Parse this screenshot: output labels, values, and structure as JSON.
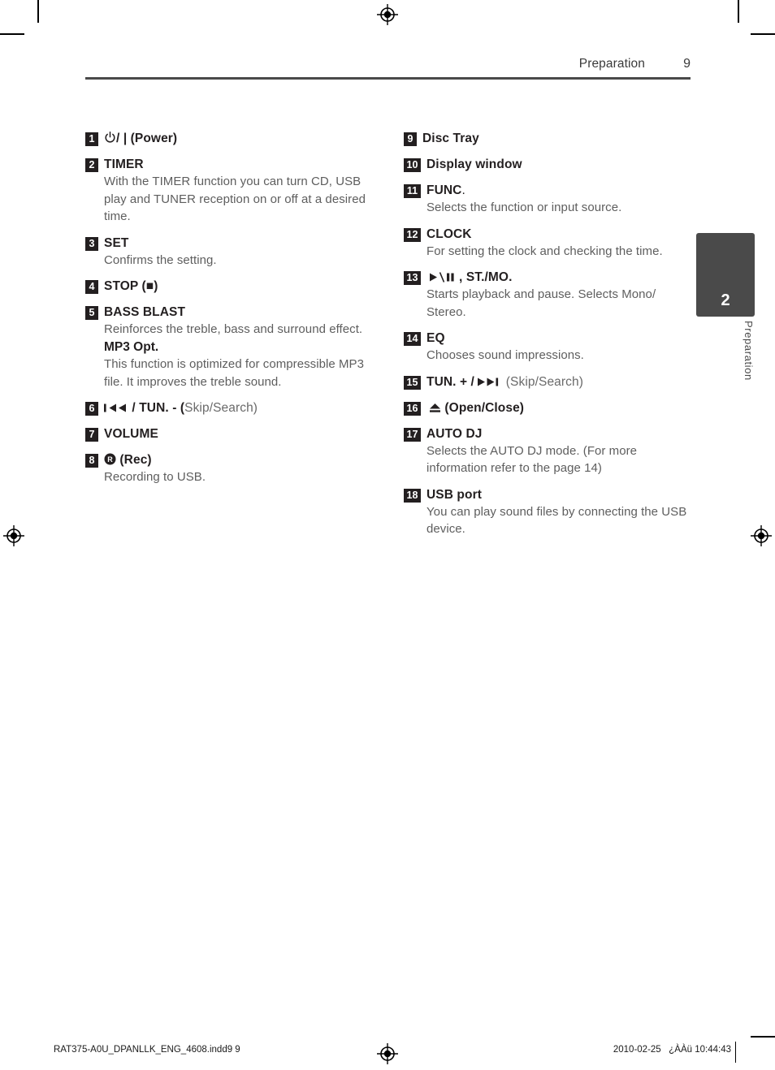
{
  "header": {
    "title": "Preparation",
    "page_number": "9"
  },
  "side_tab": {
    "number": "2",
    "label": "Preparation"
  },
  "left_column": [
    {
      "number": "1",
      "title_prefix_icon": "power-icon",
      "title": "/ | (Power)",
      "title_plain": "(Power)",
      "desc": ""
    },
    {
      "number": "2",
      "title": "TIMER",
      "desc": "With the TIMER function you can turn CD, USB play and TUNER reception on or off at a desired time."
    },
    {
      "number": "3",
      "title": "SET",
      "desc": "Confirms the setting."
    },
    {
      "number": "4",
      "title": "STOP",
      "title_suffix": "(■)",
      "desc": ""
    },
    {
      "number": "5",
      "title": "BASS BLAST",
      "desc": "Reinforces the treble, bass and surround effect.",
      "subtitle": "MP3 Opt.",
      "desc2": "This function is optimized for compressible MP3 file. It improves the treble sound."
    },
    {
      "number": "6",
      "title": "/ TUN. - (",
      "title_tail": "Skip/Search)",
      "icon": "skip-back-icon"
    },
    {
      "number": "7",
      "title": "VOLUME",
      "desc": ""
    },
    {
      "number": "8",
      "title": "(Rec)",
      "icon": "rec-icon",
      "desc": "Recording to USB."
    }
  ],
  "right_column": [
    {
      "number": "9",
      "title": "Disc Tray",
      "desc": ""
    },
    {
      "number": "10",
      "title": "Display window",
      "desc": ""
    },
    {
      "number": "11",
      "title": "FUNC",
      "title_suffix": ".",
      "desc": "Selects the function or input source."
    },
    {
      "number": "12",
      "title": "CLOCK",
      "desc": "For setting the clock and checking the time."
    },
    {
      "number": "13",
      "title": ", ST./MO.",
      "icon": "play-pause-icon",
      "desc": "Starts playback and pause. Selects Mono/ Stereo."
    },
    {
      "number": "14",
      "title": "EQ",
      "desc": "Chooses sound impressions."
    },
    {
      "number": "15",
      "title": "TUN. + /",
      "title_tail": "(Skip/Search)",
      "icon": "skip-forward-icon"
    },
    {
      "number": "16",
      "title": "(Open/Close)",
      "icon": "eject-icon"
    },
    {
      "number": "17",
      "title": "AUTO DJ",
      "desc": "Selects the AUTO DJ mode. (For more information refer to the page 14)"
    },
    {
      "number": "18",
      "title": "USB port",
      "desc": "You can play sound files by connecting the USB device."
    }
  ],
  "footer": {
    "file_name": "RAT375-A0U_DPANLLK_ENG_4608.indd9   9",
    "timestamp": "2010-02-25   ¿ÀÀü 10:44:43"
  }
}
